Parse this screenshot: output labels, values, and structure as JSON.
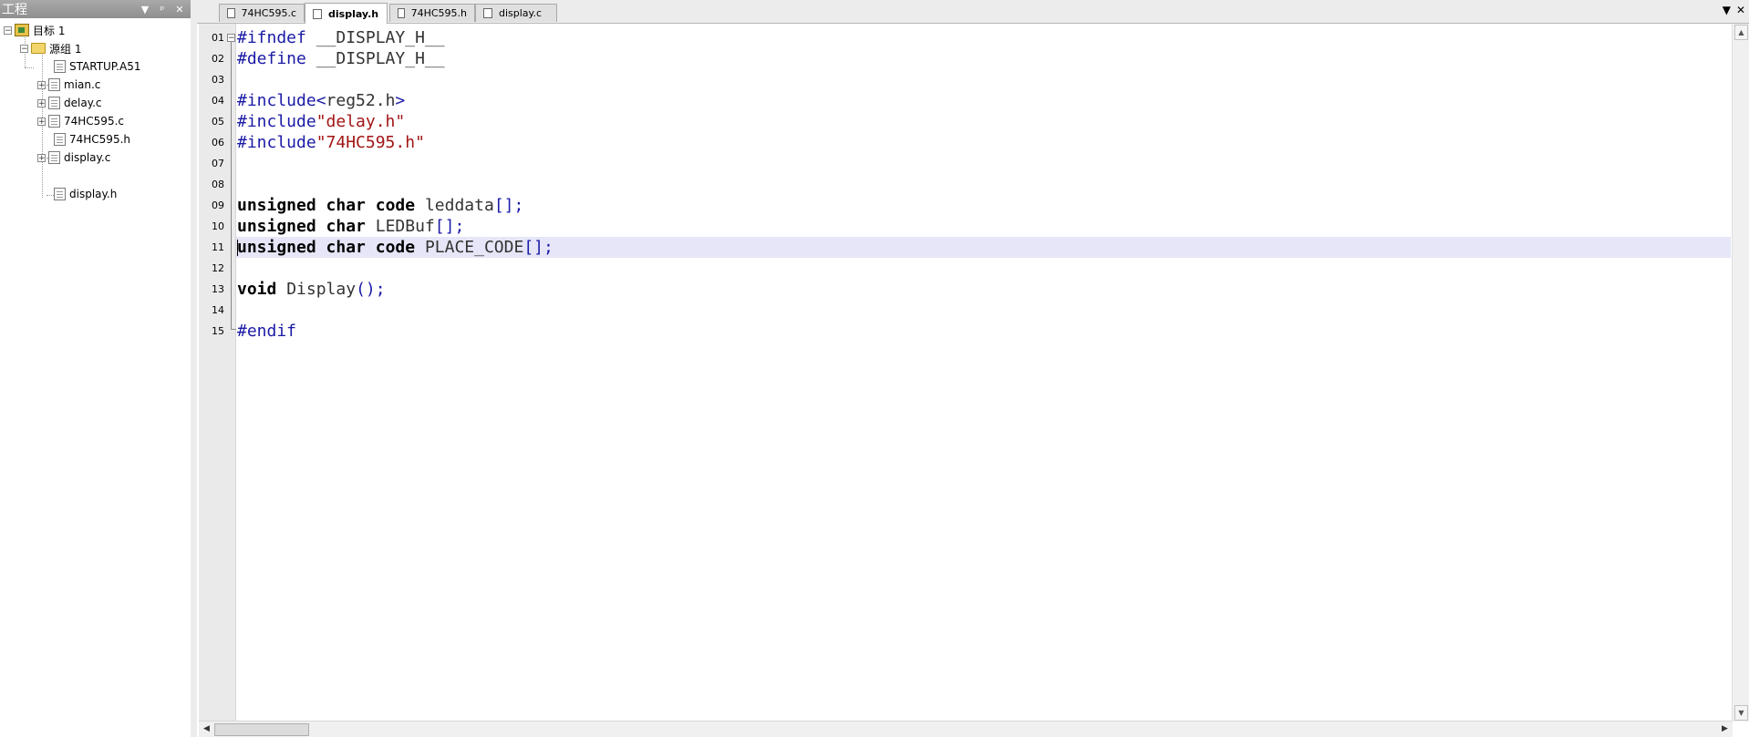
{
  "project_panel": {
    "title": "工程",
    "buttons": [
      "▼",
      "ᵖ",
      "✕"
    ],
    "tree": {
      "target": "目标 1",
      "group": "源组 1",
      "files": [
        "STARTUP.A51",
        "mian.c",
        "delay.c",
        "74HC595.c",
        "74HC595.h",
        "display.c",
        "display.h"
      ]
    }
  },
  "tabs": [
    {
      "label": "74HC595.c",
      "active": false
    },
    {
      "label": "display.h",
      "active": true
    },
    {
      "label": "74HC595.h",
      "active": false
    },
    {
      "label": "display.c",
      "active": false
    }
  ],
  "tab_controls": {
    "dropdown": "▼",
    "close": "✕"
  },
  "editor": {
    "file": "display.h",
    "current_line": 11,
    "lines": [
      {
        "num": "01",
        "text": "#ifndef __DISPLAY_H__"
      },
      {
        "num": "02",
        "text": "#define __DISPLAY_H__"
      },
      {
        "num": "03",
        "text": ""
      },
      {
        "num": "04",
        "text": "#include<reg52.h>"
      },
      {
        "num": "05",
        "text": "#include\"delay.h\""
      },
      {
        "num": "06",
        "text": "#include\"74HC595.h\""
      },
      {
        "num": "07",
        "text": ""
      },
      {
        "num": "08",
        "text": ""
      },
      {
        "num": "09",
        "text": "unsigned char code leddata[];"
      },
      {
        "num": "10",
        "text": "unsigned char LEDBuf[];"
      },
      {
        "num": "11",
        "text": "unsigned char code PLACE_CODE[];"
      },
      {
        "num": "12",
        "text": ""
      },
      {
        "num": "13",
        "text": "void Display();"
      },
      {
        "num": "14",
        "text": ""
      },
      {
        "num": "15",
        "text": "#endif"
      }
    ]
  },
  "colors": {
    "preprocessor": "#1a1aa6",
    "string": "#a31515",
    "keyword": "#000000",
    "current_line_bg": "#e6e6f8"
  }
}
